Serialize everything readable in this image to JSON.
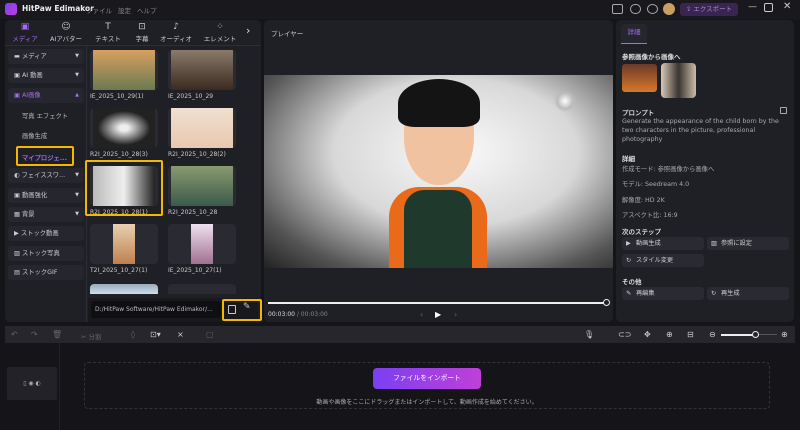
{
  "app": {
    "title": "HitPaw Edimakor",
    "menu": [
      "ファイル",
      "設定",
      "ヘルプ"
    ],
    "export_label": "エクスポート"
  },
  "tabs": [
    {
      "label": "メディア",
      "icon": "media-icon",
      "active": true
    },
    {
      "label": "AIアバター",
      "icon": "avatar-icon"
    },
    {
      "label": "テキスト",
      "icon": "text-icon"
    },
    {
      "label": "字幕",
      "icon": "subtitle-icon"
    },
    {
      "label": "オーディオ",
      "icon": "audio-icon"
    },
    {
      "label": "エレメント",
      "icon": "element-icon"
    }
  ],
  "sidebar": {
    "items": [
      {
        "label": "メディア"
      },
      {
        "label": "AI 動画"
      },
      {
        "label": "AI画像",
        "active": true
      }
    ],
    "sub": [
      "写真 エフェクト",
      "画像生成",
      "マイプロジェ..."
    ],
    "items2": [
      {
        "label": "フェイススワ..."
      },
      {
        "label": "動画強化"
      },
      {
        "label": "背景"
      },
      {
        "label": "ストック動画"
      },
      {
        "label": "ストック写真"
      },
      {
        "label": "ストックGIF"
      }
    ]
  },
  "media": [
    "IE_2025_10_29(1)",
    "IE_2025_10_29",
    "R2I_2025_10_28(3)",
    "R2I_2025_10_28(2)",
    "R2I_2025_10_28(1)",
    "R2I_2025_10_28",
    "T2I_2025_10_27(1)",
    "IE_2025_10_27(1)"
  ],
  "path": "D:/HitPaw Software/HitPaw Edimakor/...",
  "player": {
    "title": "プレイヤー",
    "current": "00:03:00",
    "total": "/ 00:03:00"
  },
  "details": {
    "tab": "詳細",
    "ref_title": "参照画像から画像へ",
    "prompt_title": "プロンプト",
    "prompt": "Generate the appearance of the child born by the two characters in the picture, professional photography",
    "detail_title": "詳細",
    "mode": "作成モード: 参照画像から画像へ",
    "model": "モデル: Seedream 4.0",
    "resolution": "解像度: HD 2K",
    "aspect": "アスペクト比: 16:9",
    "next_title": "次のステップ",
    "next": [
      "動画生成",
      "参照に設定",
      "スタイル変更"
    ],
    "other_title": "その他",
    "other": [
      "再編集",
      "再生成"
    ]
  },
  "timeline": {
    "split": "分割",
    "import": "ファイルをインポート",
    "hint": "動画や画像をここにドラッグまたはインポートして、動画作成を始めてください。"
  },
  "colors": {
    "accent": "#a56bf0",
    "highlight": "#f5b800"
  }
}
